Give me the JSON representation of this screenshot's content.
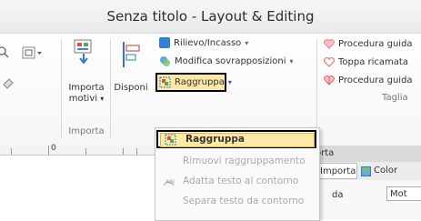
{
  "window": {
    "title": "Senza titolo - Layout & Editing"
  },
  "ribbon": {
    "import_group": {
      "import_button_line1": "Importa",
      "import_button_line2": "motivi",
      "label": "Importa"
    },
    "arrange_group": {
      "dispose_label": "Disponi",
      "relief_label": "Rilievo/Incasso",
      "modify_overlaps_label": "Modifica sovrapposizioni",
      "group_button_label": "Raggruppa"
    },
    "procedure_group": {
      "item1": "Procedura guida",
      "item2": "Toppa ricamata",
      "item3": "Procedura guida",
      "label": "Taglia"
    }
  },
  "ruler": {
    "mark": "0"
  },
  "dropdown_menu": {
    "items": [
      {
        "label": "Raggruppa",
        "enabled": true,
        "highlighted": true
      },
      {
        "label": "Rimuovi raggruppamento",
        "enabled": false
      },
      {
        "label": "Adatta testo al contorno",
        "enabled": false
      },
      {
        "label": "Separa testo da contorno",
        "enabled": false
      }
    ]
  },
  "side_panel": {
    "title_fragment": "orta",
    "tab1": "Importa",
    "tab2": "Color",
    "field_label": "da",
    "field_value": "Mot"
  },
  "colors": {
    "highlight": "#fde9a6",
    "highlight_border": "#e9b13c",
    "focus_outline": "#000000",
    "heart_icon": "#f07d88",
    "relief_icon": "#2f7fd6"
  }
}
